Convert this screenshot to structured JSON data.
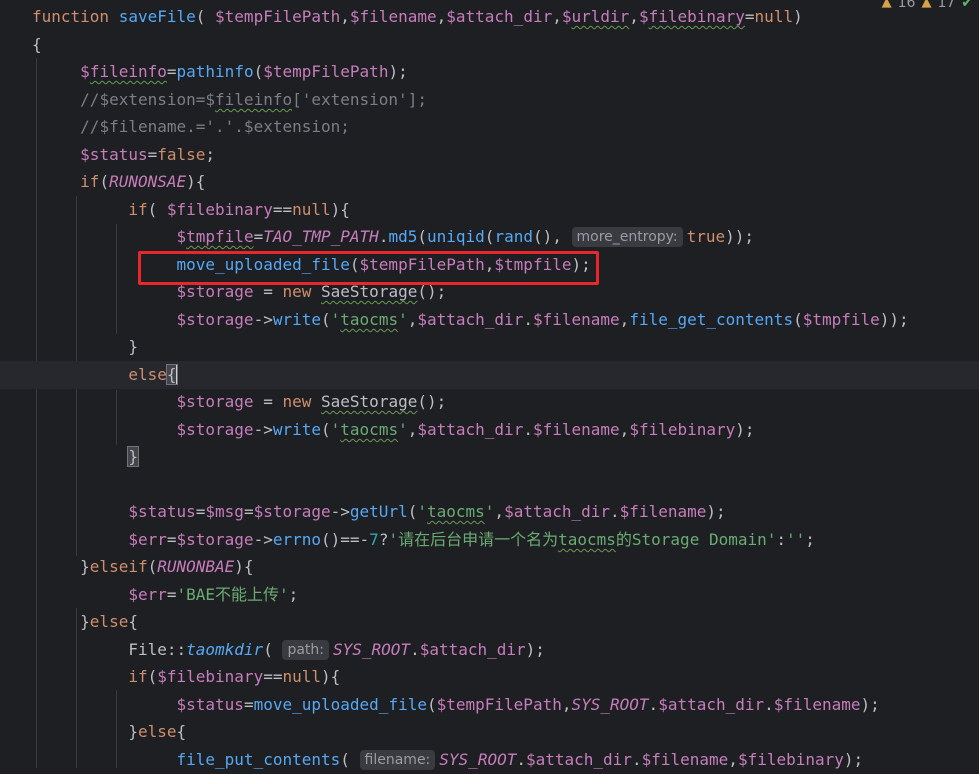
{
  "status": {
    "warnings_a": "16",
    "warnings_b": "17",
    "warn_icon": "warning-triangle-icon",
    "check_icon": "double-check-icon"
  },
  "hints": {
    "more_entropy": "more_entropy:",
    "path": "path:",
    "filename": "filename:"
  },
  "lines": [
    "function saveFile( $tempFilePath,$filename,$attach_dir,$urldir,$filebinary=null)",
    "{",
    "$fileinfo=pathinfo($tempFilePath);",
    "//$extension=$fileinfo['extension'];",
    "//$filename.='.'.$extension;",
    "$status=false;",
    "if(RUNONSAE){",
    "if( $filebinary==null){",
    "$tmpfile=TAO_TMP_PATH.md5(uniqid(rand(), true));",
    "move_uploaded_file($tempFilePath,$tmpfile);",
    "$storage = new SaeStorage();",
    "$storage->write('taocms',$attach_dir.$filename,file_get_contents($tmpfile));",
    "}",
    "else{",
    "$storage = new SaeStorage();",
    "$storage->write('taocms',$attach_dir.$filename,$filebinary);",
    "}",
    "",
    "$status=$msg=$storage->getUrl('taocms',$attach_dir.$filename);",
    "$err=$storage->errno()==-7?'请在后台申请一个名为taocms的Storage Domain':'';",
    "}elseif(RUNONBAE){",
    "$err='BAE不能上传';",
    "}else{",
    "File::taomkdir( SYS_ROOT.$attach_dir);",
    "if($filebinary==null){",
    "$status=move_uploaded_file($tempFilePath,SYS_ROOT.$attach_dir.$filename);",
    "}else{",
    "file_put_contents( SYS_ROOT.$attach_dir.$filename,$filebinary);"
  ]
}
